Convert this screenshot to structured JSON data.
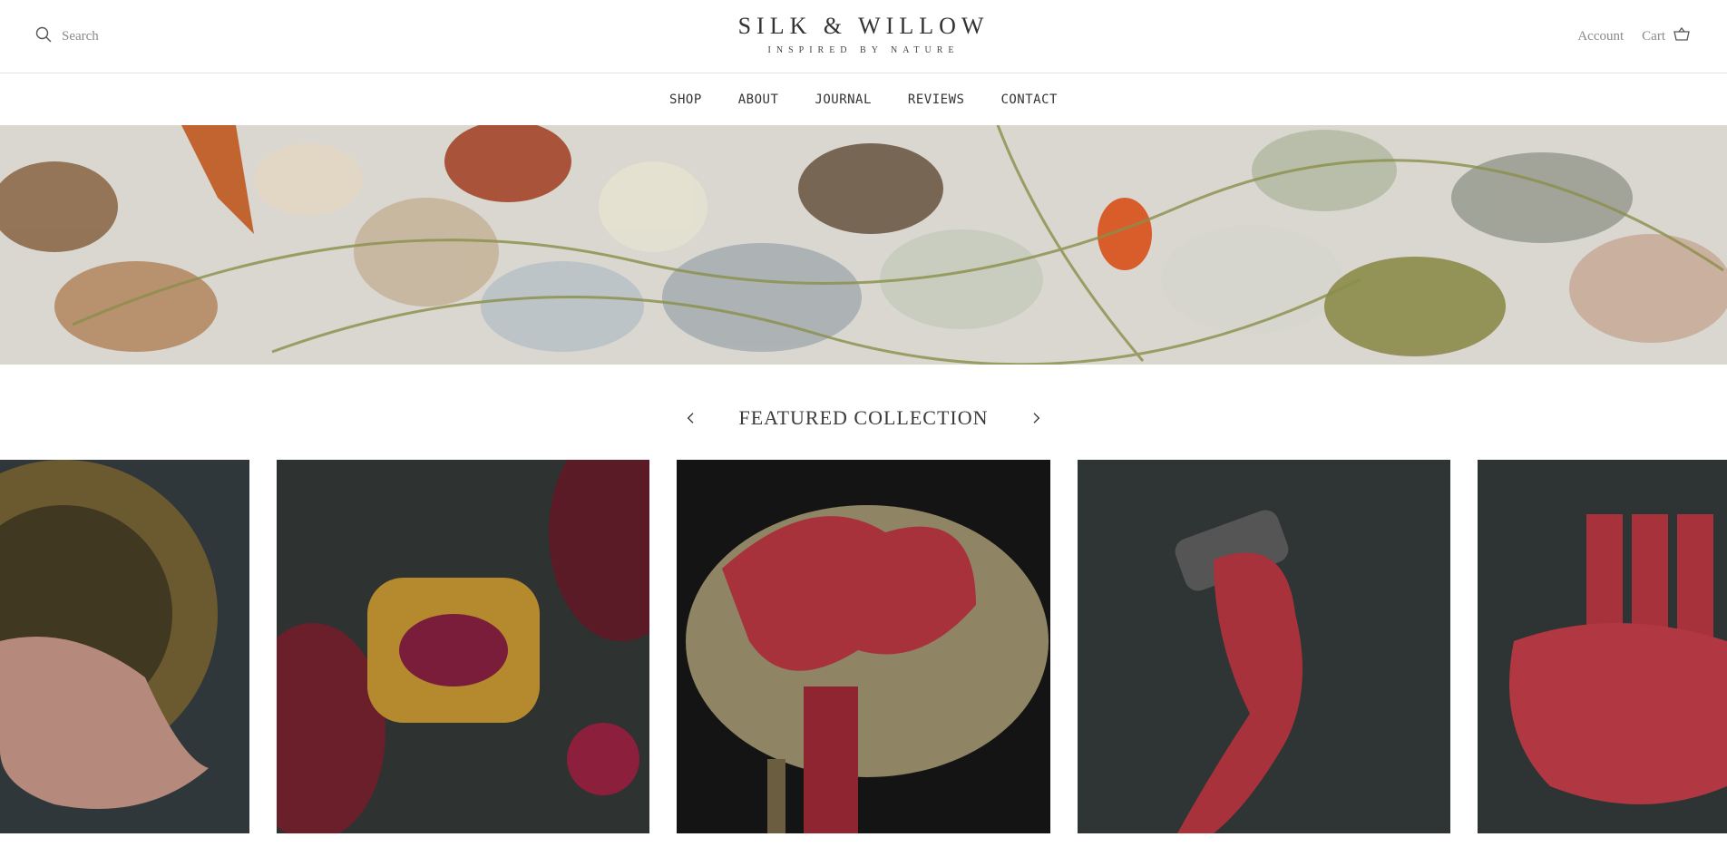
{
  "header": {
    "search_label": "Search",
    "logo_title": "SILK & WILLOW",
    "logo_tagline": "INSPIRED BY NATURE",
    "account_label": "Account",
    "cart_label": "Cart"
  },
  "nav": {
    "items": [
      "SHOP",
      "ABOUT",
      "JOURNAL",
      "REVIEWS",
      "CONTACT"
    ]
  },
  "featured": {
    "title": "FEATURED COLLECTION"
  },
  "icons": {
    "search": "search-icon",
    "cart": "basket-icon",
    "prev": "chevron-left-icon",
    "next": "chevron-right-icon"
  },
  "colors": {
    "ribbon_red": "#a8323c",
    "dark_background": "#2f3434",
    "muted_text": "#8a8a8a"
  }
}
